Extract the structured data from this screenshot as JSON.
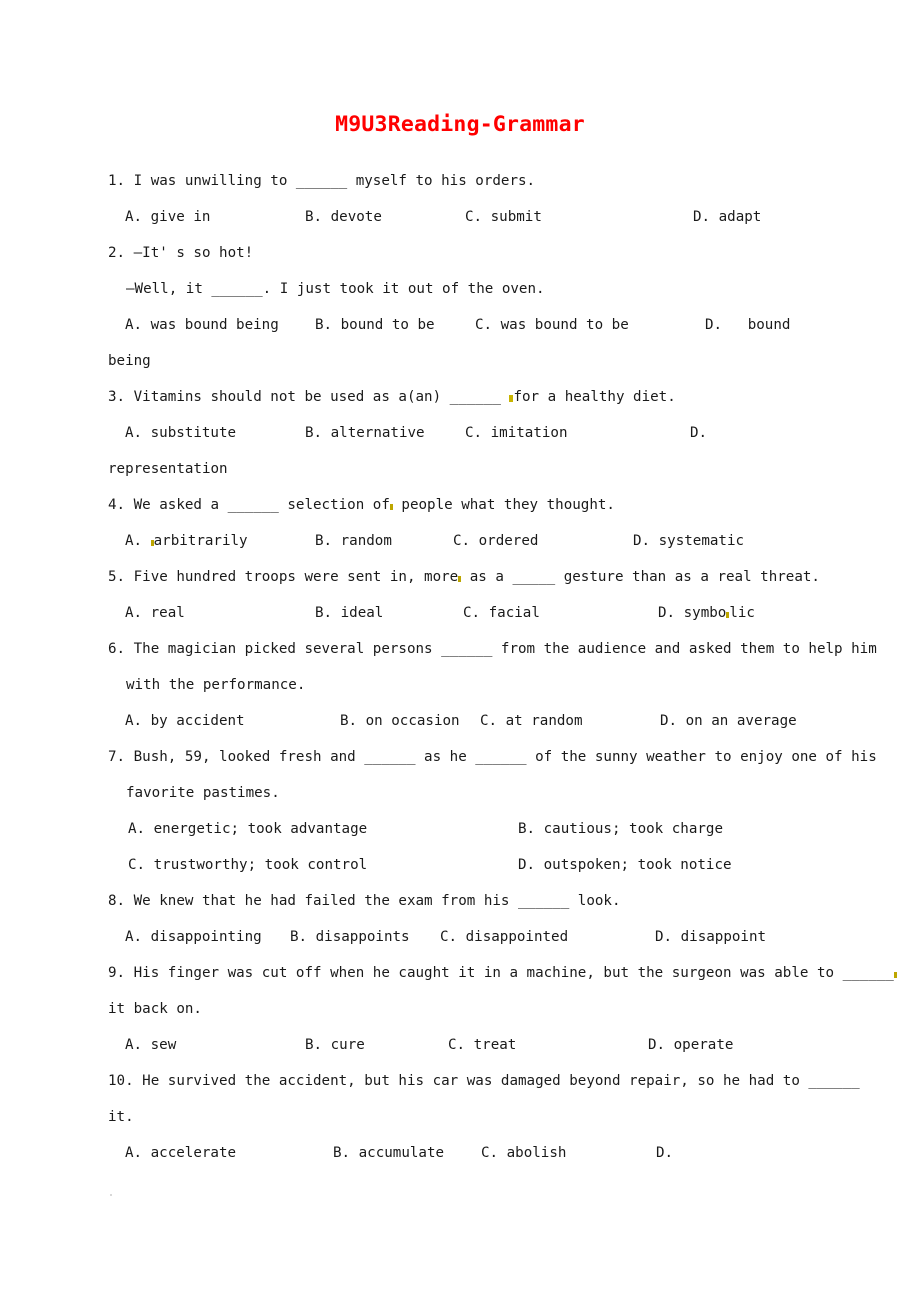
{
  "document": {
    "title": "M9U3Reading-Grammar",
    "title_color": "#ff0000",
    "body_color": "#1a1a1a",
    "background": "#ffffff",
    "artifact_color": "#c8b400"
  },
  "questions": [
    {
      "number": "1.",
      "stem": "1. I was unwilling to ______ myself to his orders.",
      "options": [
        "A. give in",
        "B. devote",
        "C. submit",
        "D. adapt"
      ]
    },
    {
      "number": "2.",
      "stem": "2. —It' s so hot!",
      "stem_cont": "—Well, it ______. I just took it out of the oven.",
      "options": [
        "A. was bound being",
        "B. bound to be",
        "C. was bound to be",
        "D.   bound"
      ],
      "option_overflow": "being"
    },
    {
      "number": "3.",
      "stem_pre": "3. Vitamins should not be used as a(an) ______ ",
      "stem_post": "for a healthy diet.",
      "options": [
        "A. substitute",
        "B. alternative",
        "C. imitation",
        "D."
      ],
      "option_overflow": "representation"
    },
    {
      "number": "4.",
      "stem_pre": "4. We asked a ______ selection of",
      "stem_post": " people what they thought.",
      "options": [
        "A. ",
        "arbitrarily",
        "B. random",
        "C. ordered",
        "D. systematic"
      ],
      "option_a_full": "A. arbitrarily"
    },
    {
      "number": "5.",
      "stem_pre": "5. Five hundred troops were sent in, more",
      "stem_post": " as a _____ gesture than as a real threat.",
      "options": [
        "A. real",
        "B. ideal",
        "C. facial",
        "D. symbo"
      ],
      "option_d_tail": "lic",
      "option_d_full": "D. symbo.lic"
    },
    {
      "number": "6.",
      "stem": "6. The magician picked several persons ______ from the audience and asked them to help him",
      "stem_cont": "with the performance.",
      "options": [
        "A. by accident",
        "B. on occasion",
        "C. at random",
        "D. on an average"
      ]
    },
    {
      "number": "7.",
      "stem": "7. Bush, 59, looked fresh and ______ as he ______ of the sunny weather to enjoy one of his",
      "stem_cont": "favorite pastimes.",
      "options_grid": [
        [
          "A. energetic; took advantage",
          "B. cautious; took charge"
        ],
        [
          "C. trustworthy; took control",
          "D. outspoken; took notice"
        ]
      ]
    },
    {
      "number": "8.",
      "stem": "8. We knew that he had failed the exam from his ______ look.",
      "options": [
        "A. disappointing",
        "B. disappoints",
        "C. disappointed",
        "D. disappoint"
      ]
    },
    {
      "number": "9.",
      "stem": "9. His finger was cut off when he caught it in a machine, but the surgeon was able to ______",
      "stem_cont": "it back on.",
      "options": [
        "A. sew",
        "B. cure",
        "C. treat",
        "D. operate"
      ]
    },
    {
      "number": "10.",
      "stem": "10. He survived the accident, but his car was damaged beyond repair, so he had to ______",
      "stem_cont": "it.",
      "options": [
        "A. accelerate",
        "B. accumulate",
        "C. abolish",
        "D."
      ]
    }
  ]
}
